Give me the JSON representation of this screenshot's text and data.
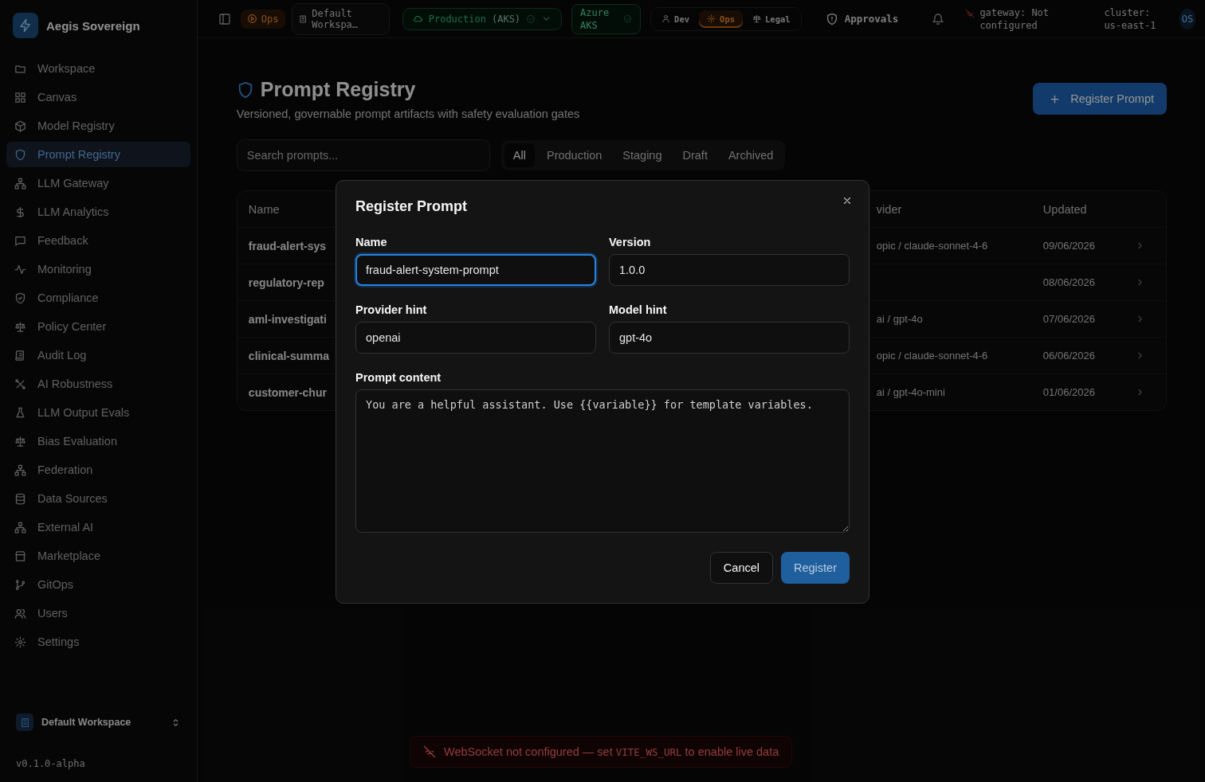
{
  "sidebar": {
    "brand": "Aegis Sovereign",
    "items": [
      {
        "label": "Workspace",
        "selected": false
      },
      {
        "label": "Canvas",
        "selected": false
      },
      {
        "label": "Model Registry",
        "selected": false
      },
      {
        "label": "Prompt Registry",
        "selected": true
      },
      {
        "label": "LLM Gateway",
        "selected": false
      },
      {
        "label": "LLM Analytics",
        "selected": false
      },
      {
        "label": "Feedback",
        "selected": false
      },
      {
        "label": "Monitoring",
        "selected": false
      },
      {
        "label": "Compliance",
        "selected": false
      },
      {
        "label": "Policy Center",
        "selected": false
      },
      {
        "label": "Audit Log",
        "selected": false
      },
      {
        "label": "AI Robustness",
        "selected": false
      },
      {
        "label": "LLM Output Evals",
        "selected": false
      },
      {
        "label": "Bias Evaluation",
        "selected": false
      },
      {
        "label": "Federation",
        "selected": false
      },
      {
        "label": "Data Sources",
        "selected": false
      },
      {
        "label": "External AI",
        "selected": false
      },
      {
        "label": "Marketplace",
        "selected": false
      },
      {
        "label": "GitOps",
        "selected": false
      },
      {
        "label": "Users",
        "selected": false
      },
      {
        "label": "Settings",
        "selected": false
      }
    ],
    "workspace": "Default Workspace",
    "version": "v0.1.0-alpha"
  },
  "topbar": {
    "mode_badge": "Ops",
    "workspace": "Default Workspa…",
    "environment": "Production",
    "environment_cluster": "(AKS)",
    "cloud": "Azure AKS",
    "roles": [
      {
        "label": "Dev",
        "selected": false
      },
      {
        "label": "Ops",
        "selected": true
      },
      {
        "label": "Legal",
        "selected": false
      }
    ],
    "approvals": "Approvals",
    "gateway": "gateway: Not configured",
    "cluster": "cluster: us-east-1",
    "avatar": "OS"
  },
  "page": {
    "title": "Prompt Registry",
    "subtitle": "Versioned, governable prompt artifacts with safety evaluation gates",
    "register_button": "Register Prompt",
    "search": {
      "placeholder": "Search prompts..."
    },
    "tabs": [
      {
        "label": "All",
        "selected": true
      },
      {
        "label": "Production",
        "selected": false
      },
      {
        "label": "Staging",
        "selected": false
      },
      {
        "label": "Draft",
        "selected": false
      },
      {
        "label": "Archived",
        "selected": false
      }
    ],
    "table": {
      "columns": [
        "Name",
        "vider",
        "Updated"
      ],
      "rows": [
        {
          "name": "fraud-alert-sys",
          "provider": "opic / claude-sonnet-4-6",
          "updated": "09/06/2026"
        },
        {
          "name": "regulatory-rep",
          "updated": "08/06/2026"
        },
        {
          "name": "aml-investigati",
          "provider": "ai / gpt-4o",
          "updated": "07/06/2026"
        },
        {
          "name": "clinical-summa",
          "provider": "opic / claude-sonnet-4-6",
          "updated": "06/06/2026"
        },
        {
          "name": "customer-chur",
          "provider": "ai / gpt-4o-mini",
          "updated": "01/06/2026"
        }
      ]
    }
  },
  "dialog": {
    "title": "Register Prompt",
    "fields": [
      {
        "kind": "input",
        "label": "Name",
        "value": "fraud-alert-system-prompt",
        "focused": true
      },
      {
        "kind": "input",
        "label": "Version",
        "value": "1.0.0",
        "focused": false
      },
      {
        "kind": "input",
        "label": "Provider hint",
        "value": "openai",
        "focused": false
      },
      {
        "kind": "input",
        "label": "Model hint",
        "value": "gpt-4o",
        "focused": false
      },
      {
        "kind": "textarea",
        "label": "Prompt content",
        "value": "You are a helpful assistant. Use {{variable}} for template variables.",
        "focused": false
      }
    ],
    "buttons": [
      {
        "label": "Cancel",
        "kind": "secondary"
      },
      {
        "label": "Register",
        "kind": "primary"
      }
    ]
  },
  "toast": {
    "text_before": "WebSocket not configured — set ",
    "code": "VITE_WS_URL",
    "text_after": " to enable live data"
  }
}
